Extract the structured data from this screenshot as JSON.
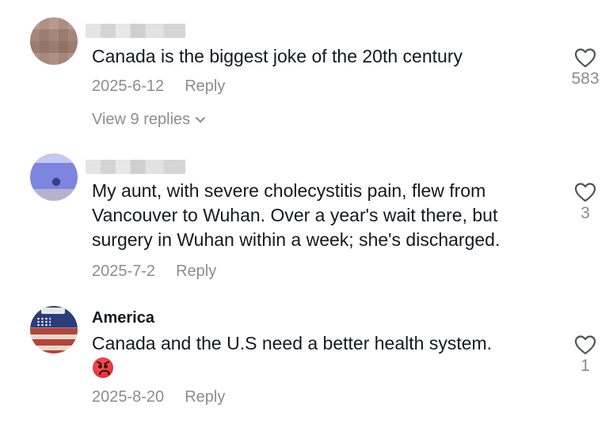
{
  "comments": [
    {
      "username": "",
      "text": "Canada is the biggest joke of the 20th century",
      "date": "2025-6-12",
      "reply_label": "Reply",
      "likes": "583",
      "view_replies": "View 9 replies"
    },
    {
      "username": "",
      "text": "My aunt, with severe cholecystitis pain, flew from Vancouver to Wuhan. Over a year's wait there, but surgery in Wuhan within a week; she's discharged.",
      "date": "2025-7-2",
      "reply_label": "Reply",
      "likes": "3"
    },
    {
      "username": "America",
      "text": "Canada and the U.S need a better health system.",
      "emoji": "angry-face",
      "date": "2025-8-20",
      "reply_label": "Reply",
      "likes": "1"
    }
  ],
  "icons": {
    "like": "heart-outline-icon",
    "expand": "chevron-down-icon"
  },
  "colors": {
    "text": "#161823",
    "muted": "rgba(22,24,35,0.5)"
  }
}
